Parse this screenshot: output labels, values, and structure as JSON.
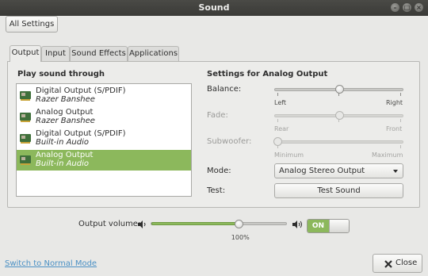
{
  "window": {
    "title": "Sound"
  },
  "toolbar": {
    "all_settings_label": "All Settings"
  },
  "tabs": [
    {
      "label": "Output",
      "active": true
    },
    {
      "label": "Input",
      "active": false
    },
    {
      "label": "Sound Effects",
      "active": false
    },
    {
      "label": "Applications",
      "active": false
    }
  ],
  "output": {
    "list_title": "Play sound through",
    "devices": [
      {
        "name": "Digital Output (S/PDIF)",
        "sub": "Razer Banshee",
        "selected": false
      },
      {
        "name": "Analog Output",
        "sub": "Razer Banshee",
        "selected": false
      },
      {
        "name": "Digital Output (S/PDIF)",
        "sub": "Built-in Audio",
        "selected": false
      },
      {
        "name": "Analog Output",
        "sub": "Built-in Audio",
        "selected": true
      }
    ],
    "settings_title": "Settings for Analog Output",
    "balance": {
      "label": "Balance:",
      "left": "Left",
      "right": "Right",
      "value": 0.5
    },
    "fade": {
      "label": "Fade:",
      "left": "Rear",
      "right": "Front",
      "value": 0.5
    },
    "subwoofer": {
      "label": "Subwoofer:",
      "left": "Minimum",
      "right": "Maximum",
      "value": 0
    },
    "mode": {
      "label": "Mode:",
      "value": "Analog Stereo Output"
    },
    "test": {
      "label": "Test:",
      "button": "Test Sound"
    }
  },
  "volume": {
    "label": "Output volume:",
    "percent_label": "100%",
    "value": 0.65,
    "toggle": "ON",
    "toggle_on": true
  },
  "footer": {
    "mode_link": "Switch to Normal Mode",
    "close": "Close"
  },
  "colors": {
    "accent": "#8cb85c",
    "link": "#4a90c4",
    "titlebar": "#3c3c3a"
  }
}
